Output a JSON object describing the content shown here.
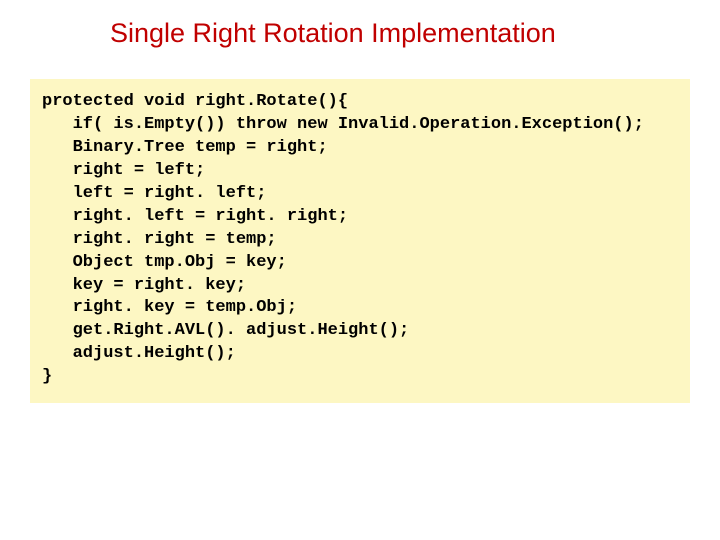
{
  "title": "Single Right Rotation Implementation",
  "code": "protected void right.Rotate(){\n   if( is.Empty()) throw new Invalid.Operation.Exception();\n   Binary.Tree temp = right;\n   right = left;\n   left = right. left;\n   right. left = right. right;\n   right. right = temp;\n   Object tmp.Obj = key;\n   key = right. key;\n   right. key = temp.Obj;\n   get.Right.AVL(). adjust.Height();\n   adjust.Height();\n}"
}
